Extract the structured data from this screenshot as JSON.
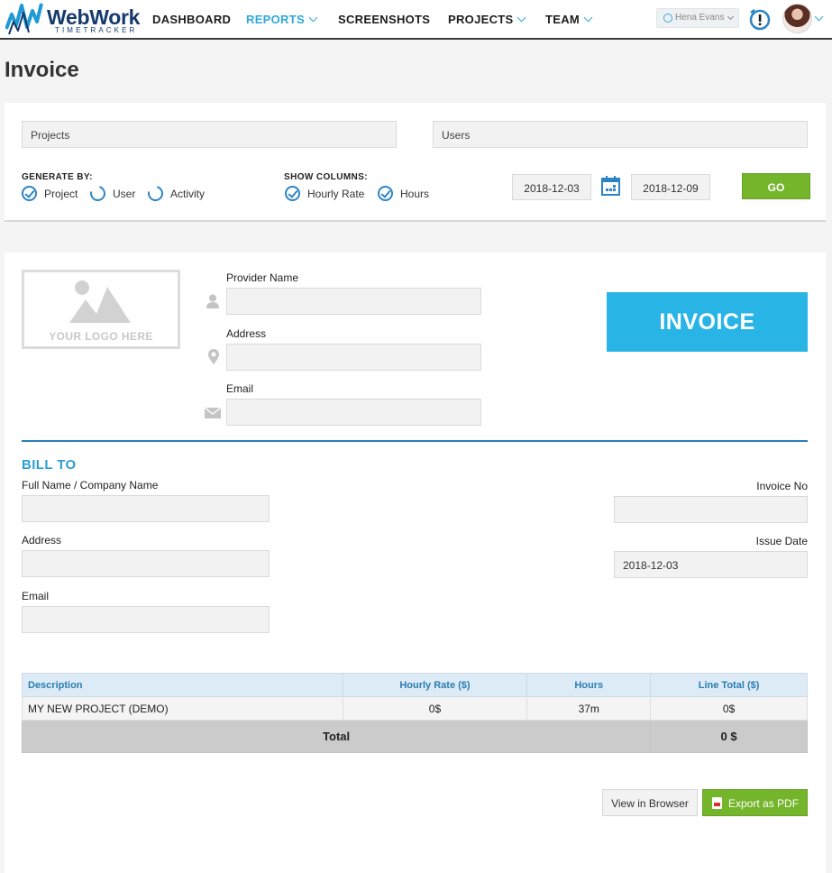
{
  "nav": {
    "logo": {
      "name": "WebWork",
      "tagline": "TIMETRACKER"
    },
    "items": [
      {
        "label": "DASHBOARD",
        "active": false,
        "dropdown": false
      },
      {
        "label": "REPORTS",
        "active": true,
        "dropdown": true
      },
      {
        "label": "SCREENSHOTS",
        "active": false,
        "dropdown": false
      },
      {
        "label": "PROJECTS",
        "active": false,
        "dropdown": true
      },
      {
        "label": "TEAM",
        "active": false,
        "dropdown": true
      }
    ],
    "user_select": "Hena Evans"
  },
  "page": {
    "title": "Invoice"
  },
  "filters": {
    "projects_placeholder": "Projects",
    "users_placeholder": "Users",
    "generate_by": {
      "label": "GENERATE BY:",
      "options": [
        {
          "label": "Project",
          "checked": true
        },
        {
          "label": "User",
          "checked": false
        },
        {
          "label": "Activity",
          "checked": false
        }
      ]
    },
    "show_columns": {
      "label": "SHOW COLUMNS:",
      "options": [
        {
          "label": "Hourly Rate",
          "checked": true
        },
        {
          "label": "Hours",
          "checked": true
        }
      ]
    },
    "date_from": "2018-12-03",
    "date_to": "2018-12-09",
    "go_label": "GO"
  },
  "invoice": {
    "logo_placeholder": "YOUR LOGO HERE",
    "badge": "INVOICE",
    "provider": {
      "name_label": "Provider Name",
      "name_value": "",
      "address_label": "Address",
      "address_value": "",
      "email_label": "Email",
      "email_value": ""
    },
    "bill_to": {
      "title": "BILL TO",
      "name_label": "Full Name / Company Name",
      "name_value": "",
      "address_label": "Address",
      "address_value": "",
      "email_label": "Email",
      "email_value": ""
    },
    "meta": {
      "invoice_no_label": "Invoice No",
      "invoice_no_value": "",
      "issue_date_label": "Issue Date",
      "issue_date_value": "2018-12-03"
    },
    "table": {
      "headers": [
        "Description",
        "Hourly Rate ($)",
        "Hours",
        "Line Total ($)"
      ],
      "rows": [
        [
          "MY NEW PROJECT (DEMO)",
          "0$",
          "37m",
          "0$"
        ]
      ],
      "total_label": "Total",
      "total_value": "0 $"
    },
    "actions": {
      "view_label": "View in Browser",
      "export_label": "Export as PDF"
    }
  }
}
